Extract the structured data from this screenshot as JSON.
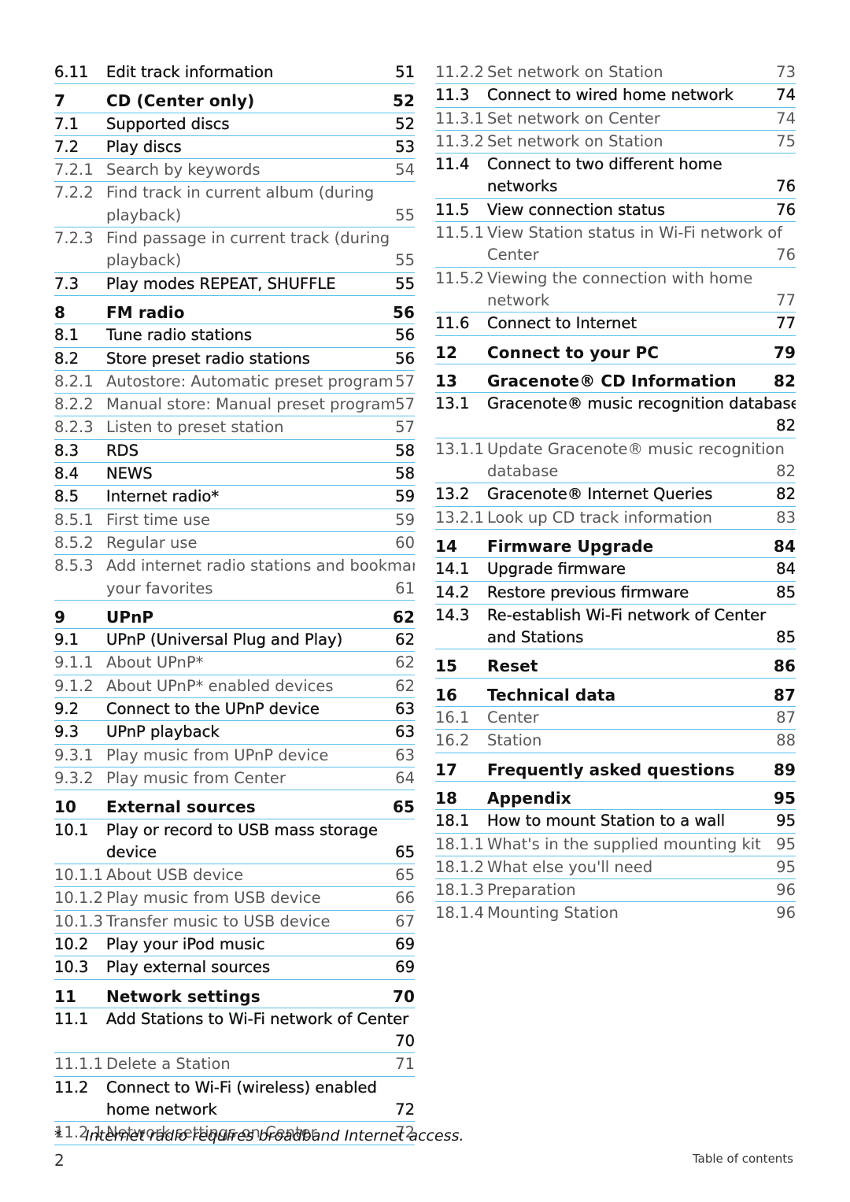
{
  "document": {
    "page_number": "2",
    "section_label": "Table of contents",
    "footnote": {
      "marker": "*",
      "text": "Internet radio requires broadband Internet access."
    },
    "colors": {
      "rule": "#5bc0eb",
      "chapter_text": "#111111",
      "subsection_text": "#555555"
    }
  },
  "toc": {
    "left": [
      {
        "level": "section",
        "num": "6.11",
        "lines": [
          "Edit track information"
        ],
        "page": "51"
      },
      {
        "level": "chapter",
        "num": "7",
        "lines": [
          "CD (Center  only)"
        ],
        "page": "52"
      },
      {
        "level": "section",
        "num": "7.1",
        "lines": [
          "Supported discs"
        ],
        "page": "52"
      },
      {
        "level": "section",
        "num": "7.2",
        "lines": [
          "Play discs"
        ],
        "page": "53"
      },
      {
        "level": "sub",
        "num": "7.2.1",
        "lines": [
          "Search by keywords"
        ],
        "page": "54"
      },
      {
        "level": "sub",
        "num": "7.2.2",
        "lines": [
          "Find track in current album (during",
          "playback)"
        ],
        "page": "55"
      },
      {
        "level": "sub",
        "num": "7.2.3",
        "lines": [
          "Find passage in current track (during",
          "playback)"
        ],
        "page": "55"
      },
      {
        "level": "section",
        "num": "7.3",
        "lines": [
          "Play modes REPEAT, SHUFFLE"
        ],
        "page": "55"
      },
      {
        "level": "chapter",
        "num": "8",
        "lines": [
          "FM radio"
        ],
        "page": "56"
      },
      {
        "level": "section",
        "num": "8.1",
        "lines": [
          "Tune radio stations"
        ],
        "page": "56"
      },
      {
        "level": "section",
        "num": "8.2",
        "lines": [
          "Store preset radio stations"
        ],
        "page": "56"
      },
      {
        "level": "sub",
        "num": "8.2.1",
        "lines": [
          "Autostore:  Automatic preset program"
        ],
        "page": "57"
      },
      {
        "level": "sub",
        "num": "8.2.2",
        "lines": [
          "Manual store: Manual preset program"
        ],
        "page": "57"
      },
      {
        "level": "sub",
        "num": "8.2.3",
        "lines": [
          "Listen to preset station"
        ],
        "page": "57"
      },
      {
        "level": "section",
        "num": "8.3",
        "lines": [
          "RDS"
        ],
        "page": "58"
      },
      {
        "level": "section",
        "num": "8.4",
        "lines": [
          "NEWS"
        ],
        "page": "58"
      },
      {
        "level": "section",
        "num": "8.5",
        "lines": [
          "Internet radio*"
        ],
        "page": "59"
      },
      {
        "level": "sub",
        "num": "8.5.1",
        "lines": [
          "First time use"
        ],
        "page": "59"
      },
      {
        "level": "sub",
        "num": "8.5.2",
        "lines": [
          "Regular use"
        ],
        "page": "60"
      },
      {
        "level": "sub",
        "num": "8.5.3",
        "lines": [
          "Add internet radio stations and bookmark",
          "your favorites"
        ],
        "page": "61"
      },
      {
        "level": "chapter",
        "num": "9",
        "lines": [
          "UPnP"
        ],
        "page": "62"
      },
      {
        "level": "section",
        "num": "9.1",
        "lines": [
          "UPnP (Universal Plug and Play)"
        ],
        "page": "62"
      },
      {
        "level": "sub",
        "num": "9.1.1",
        "lines": [
          "About UPnP*"
        ],
        "page": "62"
      },
      {
        "level": "sub",
        "num": "9.1.2",
        "lines": [
          "About UPnP* enabled devices"
        ],
        "page": "62"
      },
      {
        "level": "section",
        "num": "9.2",
        "lines": [
          "Connect to the UPnP device"
        ],
        "page": "63"
      },
      {
        "level": "section",
        "num": "9.3",
        "lines": [
          "UPnP playback"
        ],
        "page": "63"
      },
      {
        "level": "sub",
        "num": "9.3.1",
        "lines": [
          "Play music from UPnP device"
        ],
        "page": "63"
      },
      {
        "level": "sub",
        "num": "9.3.2",
        "lines": [
          "Play music from Center"
        ],
        "page": "64"
      },
      {
        "level": "chapter",
        "num": "10",
        "lines": [
          "External sources"
        ],
        "page": "65"
      },
      {
        "level": "section",
        "num": "10.1",
        "lines": [
          "Play or record to USB mass storage",
          "device"
        ],
        "page": "65"
      },
      {
        "level": "sub",
        "num": "10.1.1",
        "lines": [
          "About USB device"
        ],
        "page": "65"
      },
      {
        "level": "sub",
        "num": "10.1.2",
        "lines": [
          "Play music from USB device"
        ],
        "page": "66"
      },
      {
        "level": "sub",
        "num": "10.1.3",
        "lines": [
          "Transfer music to USB device"
        ],
        "page": "67"
      },
      {
        "level": "section",
        "num": "10.2",
        "lines": [
          "Play your iPod music"
        ],
        "page": "69"
      },
      {
        "level": "section",
        "num": "10.3",
        "lines": [
          "Play external sources"
        ],
        "page": "69"
      },
      {
        "level": "chapter",
        "num": "11",
        "lines": [
          "Network settings"
        ],
        "page": "70"
      },
      {
        "level": "section",
        "num": "11.1",
        "lines": [
          "Add Stations to Wi-Fi network of Center",
          ""
        ],
        "page": "70"
      },
      {
        "level": "sub",
        "num": "11.1.1",
        "lines": [
          "Delete a Station"
        ],
        "page": "71"
      },
      {
        "level": "section",
        "num": "11.2",
        "lines": [
          "Connect to Wi-Fi (wireless) enabled",
          "home network"
        ],
        "page": "72"
      },
      {
        "level": "sub",
        "num": "11.2.1",
        "lines": [
          "Network settings on Center"
        ],
        "page": "72"
      }
    ],
    "right": [
      {
        "level": "sub",
        "num": "11.2.2",
        "lines": [
          "Set network on Station"
        ],
        "page": "73"
      },
      {
        "level": "section",
        "num": "11.3",
        "lines": [
          "Connect to wired home network"
        ],
        "page": "74"
      },
      {
        "level": "sub",
        "num": "11.3.1",
        "lines": [
          "Set network on Center"
        ],
        "page": "74"
      },
      {
        "level": "sub",
        "num": "11.3.2",
        "lines": [
          "Set network on Station"
        ],
        "page": "75"
      },
      {
        "level": "section",
        "num": "11.4",
        "lines": [
          "Connect to two different home",
          "networks"
        ],
        "page": "76"
      },
      {
        "level": "section",
        "num": "11.5",
        "lines": [
          "View connection status"
        ],
        "page": "76"
      },
      {
        "level": "sub",
        "num": "11.5.1",
        "lines": [
          "View Station status in Wi-Fi network of",
          "Center"
        ],
        "page": "76"
      },
      {
        "level": "sub",
        "num": "11.5.2",
        "lines": [
          "Viewing the connection with home",
          "network"
        ],
        "page": "77"
      },
      {
        "level": "section",
        "num": "11.6",
        "lines": [
          "Connect to Internet"
        ],
        "page": "77"
      },
      {
        "level": "chapter",
        "num": "12",
        "lines": [
          "Connect to your PC"
        ],
        "page": "79"
      },
      {
        "level": "chapter",
        "num": "13",
        "lines": [
          "Gracenote® CD Information"
        ],
        "page": "82"
      },
      {
        "level": "section",
        "num": "13.1",
        "lines": [
          "Gracenote® music recognition database",
          ""
        ],
        "page": "82"
      },
      {
        "level": "sub",
        "num": "13.1.1",
        "lines": [
          "Update Gracenote® music recognition",
          "database"
        ],
        "page": "82"
      },
      {
        "level": "section",
        "num": "13.2",
        "lines": [
          "Gracenote® Internet Queries"
        ],
        "page": "82"
      },
      {
        "level": "sub",
        "num": "13.2.1",
        "lines": [
          "Look up CD track information"
        ],
        "page": "83"
      },
      {
        "level": "chapter",
        "num": "14",
        "lines": [
          "Firmware Upgrade"
        ],
        "page": "84"
      },
      {
        "level": "section",
        "num": "14.1",
        "lines": [
          "Upgrade firmware"
        ],
        "page": "84"
      },
      {
        "level": "section",
        "num": "14.2",
        "lines": [
          "Restore previous firmware"
        ],
        "page": "85"
      },
      {
        "level": "section",
        "num": "14.3",
        "lines": [
          "Re-establish Wi-Fi network of Center",
          "and Stations"
        ],
        "page": "85"
      },
      {
        "level": "chapter",
        "num": "15",
        "lines": [
          "Reset"
        ],
        "page": "86"
      },
      {
        "level": "chapter",
        "num": "16",
        "lines": [
          "Technical data"
        ],
        "page": "87"
      },
      {
        "level": "sub",
        "num": "16.1",
        "lines": [
          "Center"
        ],
        "page": "87"
      },
      {
        "level": "sub",
        "num": "16.2",
        "lines": [
          "Station"
        ],
        "page": "88"
      },
      {
        "level": "chapter",
        "num": "17",
        "lines": [
          "Frequently asked questions"
        ],
        "page": "89"
      },
      {
        "level": "chapter",
        "num": "18",
        "lines": [
          "Appendix"
        ],
        "page": "95"
      },
      {
        "level": "section",
        "num": "18.1",
        "lines": [
          "How to mount Station to a wall"
        ],
        "page": "95"
      },
      {
        "level": "sub",
        "num": "18.1.1",
        "lines": [
          "What's in the supplied mounting kit"
        ],
        "page": "95"
      },
      {
        "level": "sub",
        "num": "18.1.2",
        "lines": [
          "What else you'll need"
        ],
        "page": "95"
      },
      {
        "level": "sub",
        "num": "18.1.3",
        "lines": [
          "Preparation"
        ],
        "page": "96"
      },
      {
        "level": "sub",
        "num": "18.1.4",
        "lines": [
          "Mounting Station"
        ],
        "page": "96",
        "no_rule": true
      }
    ]
  }
}
